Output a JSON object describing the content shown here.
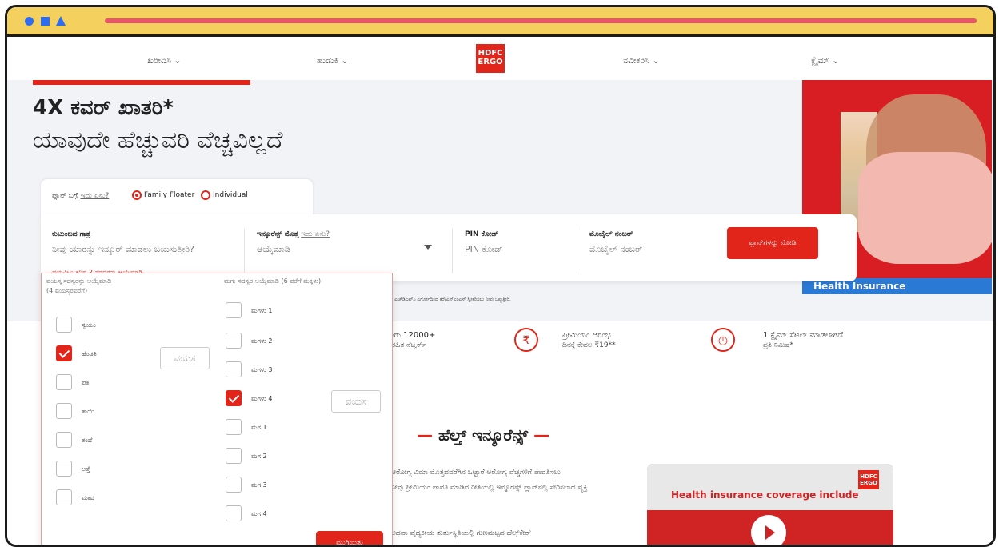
{
  "window": {
    "title": ""
  },
  "nav": {
    "items": [
      {
        "label": "ಖರೀದಿಸಿ ⌄"
      },
      {
        "label": "ಹುಡುಕಿ ⌄"
      },
      {
        "label": "ನವೀಕರಿಸಿ ⌄"
      },
      {
        "label": "ಕ್ಲೈಮ್ ⌄"
      }
    ],
    "logo_text": [
      "HDFC",
      "ERGO"
    ]
  },
  "hero": {
    "title": "4X ಕವರ್ ಖಾತರಿ*",
    "subtitle": "ಯಾವುದೇ ಹೆಚ್ಚುವರಿ ವೆಚ್ಚವಿಲ್ಲದೆ",
    "banner_label": "Health Insurance"
  },
  "plan_type": {
    "label": "ಪ್ಲಾನ್ ಬಗ್ಗೆ",
    "help_link": "ಇದು ಏನು?",
    "options": [
      "Family Floater",
      "Individual"
    ],
    "selected": "Family Floater"
  },
  "form": {
    "family": {
      "label": "ಕುಟುಂಬದ ಗಾತ್ರ",
      "placeholder": "ನೀವು ಯಾರನ್ನು ಇನ್ಶೂರ್ ಮಾಡಲು ಬಯಸುತ್ತೀರಿ?",
      "error": "ದಯವಿಟ್ಟು ಕನಿಷ್ಠ 2 ಸದಸ್ಯರನ್ನು ಆಯ್ಕೆಮಾಡಿ"
    },
    "sum_insured": {
      "label": "ಇನ್ಶೂರೆನ್ಸ್ ಮೊತ್ತ",
      "help_link": "ಇದು ಏನು?",
      "placeholder": "ಆಯ್ಕೆಮಾಡಿ"
    },
    "pin": {
      "label": "PIN ಕೋಡ್",
      "placeholder": "PIN ಕೋಡ್"
    },
    "mobile": {
      "label": "ಮೊಬೈಲ್ ನಂಬರ್",
      "placeholder": "ಮೊಬೈಲ್ ನಂಬರ್"
    },
    "cta": "ಪ್ಲಾನ್‌ಗಳನ್ನು ನೋಡಿ",
    "note": "ಎಚ್‌ಡಿಎಫ್‌ಸಿ ಎರ್ಗೋದಿಂದ ಕರೆ/ಎಸ್‌ಎಂಎಸ್ ಸ್ವೀಕರಿಸಲು ನೀವು ಒಪ್ಪುತ್ತೀರಿ."
  },
  "dropdown": {
    "adult_header": "ವಯಸ್ಕ ಸದಸ್ಯರನ್ನು ಆಯ್ಕೆಮಾಡಿ",
    "adult_sub": "(4 ವಯಸ್ಕರವರೆಗೆ)",
    "child_header": "ಮಗು ಸದಸ್ಯರ ಆಯ್ಕೆಮಾಡಿ (6 ವರೆಗೆ ಮಕ್ಕಳು)",
    "age_placeholder": "ವಯಸ",
    "adults": [
      {
        "label": "ಸ್ವಯಂ",
        "checked": false
      },
      {
        "label": "ಹೆಂಡತಿ",
        "checked": true
      },
      {
        "label": "ಪತಿ",
        "checked": false
      },
      {
        "label": "ತಾಯಿ",
        "checked": false
      },
      {
        "label": "ತಂದೆ",
        "checked": false
      },
      {
        "label": "ಅತ್ತೆ",
        "checked": false
      },
      {
        "label": "ಮಾವ",
        "checked": false
      }
    ],
    "children": [
      {
        "label": "ಮಗಳು 1",
        "checked": false
      },
      {
        "label": "ಮಗಳು 2",
        "checked": false
      },
      {
        "label": "ಮಗಳು 3",
        "checked": false
      },
      {
        "label": "ಮಗಳು 4",
        "checked": true
      },
      {
        "label": "ಮಗ 1",
        "checked": false
      },
      {
        "label": "ಮಗ 2",
        "checked": false
      },
      {
        "label": "ಮಗ 3",
        "checked": false
      },
      {
        "label": "ಮಗ 4",
        "checked": false
      }
    ],
    "done": "ಮುಗಿಯಿತು"
  },
  "features": [
    {
      "title": "ಸುಮಾರು 12000+",
      "sub": "ನಗದುರಹಿತ ನೆಟ್ವರ್ಕ್"
    },
    {
      "title": "ಪ್ರೀಮಿಯಂ ಆರಂಭ",
      "sub": "ದಿನಕ್ಕೆ ಕೇವಲ ₹19**",
      "icon": "₹"
    },
    {
      "title": "1 ಕ್ಲೈಮ್ ಸೆಟಲ್ ಮಾಡಲಾಗಿದೆ",
      "sub": "ಪ್ರತಿ ನಿಮಿಷ*",
      "icon": "◷"
    }
  ],
  "section": {
    "title": "ಹೆಲ್ತ್ ಇನ್ಶೂರೆನ್ಸ್",
    "para1": "ಆರೋಗ್ಯ ವಿಮಾ ಮೊತ್ತದವರೆಗಿನ ಒಟ್ಟಾರೆ ಆರೋಗ್ಯ ವೆಚ್ಚಗಳಿಗೆ ಪಾವತಿಸಲು",
    "para2": "ನೀವು ಪ್ರೀಮಿಯಂ ಪಾವತಿ ಮಾಡಿದ ರೀತಿಯಲ್ಲಿ ಇನ್ಶೂರೆನ್ಸ್ ಪ್ಲಾನ್‌ನಲ್ಲಿ ಸೇರಿಸಲಾದ ವ್ಯಕ್ತಿ",
    "para3": "ಅಥವಾ ವೈದ್ಯಕೀಯ ತುರ್ತುಸ್ಥಿತಿಯಲ್ಲಿ ಗುಣಮಟ್ಟದ ಹೆಲ್ತ್‌ಕೇರ್",
    "video_title": "Health insurance coverage include"
  },
  "colors": {
    "brand": "#e1251b",
    "chrome": "#f4d15e",
    "accent": "#2f6df0"
  }
}
